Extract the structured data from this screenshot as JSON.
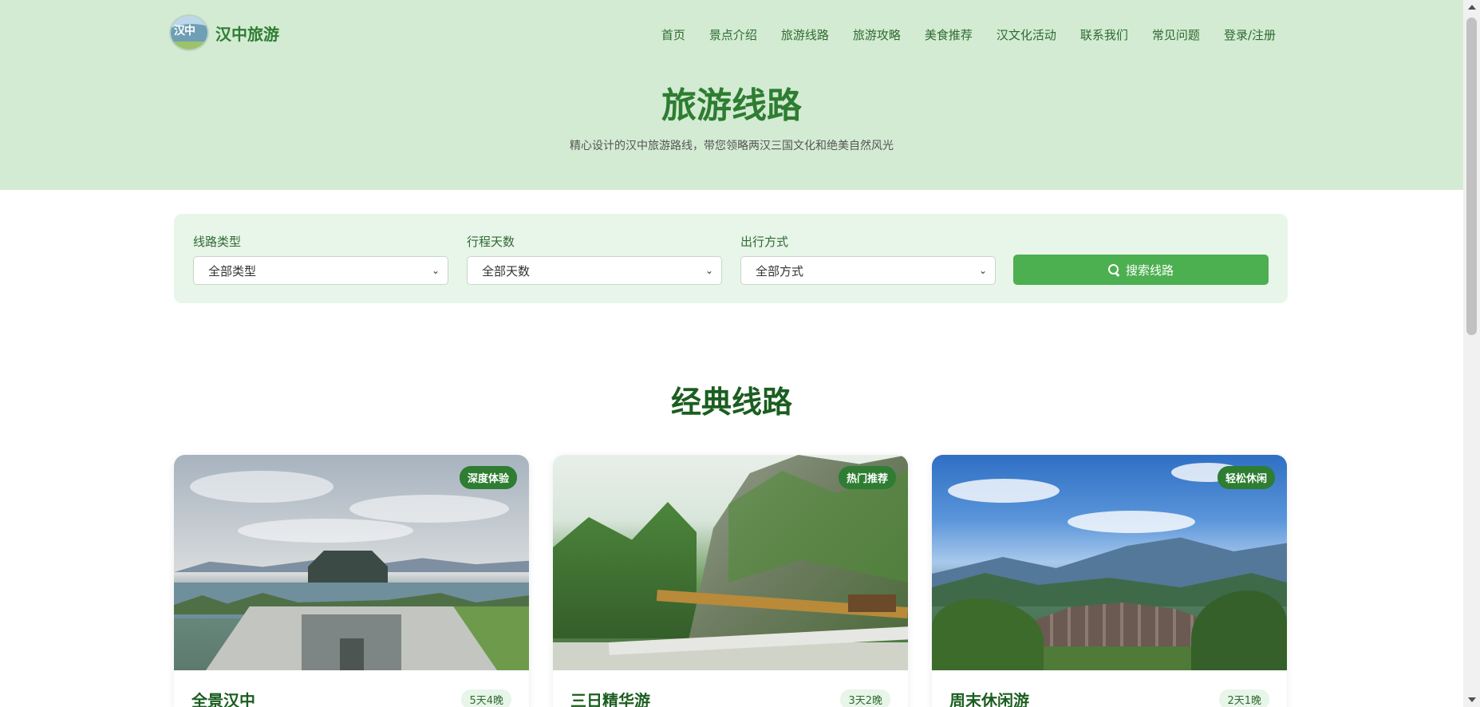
{
  "brand": {
    "name": "汉中旅游",
    "logo_glyph": "汉中"
  },
  "nav": {
    "items": [
      "首页",
      "景点介绍",
      "旅游线路",
      "旅游攻略",
      "美食推荐",
      "汉文化活动",
      "联系我们",
      "常见问题",
      "登录/注册"
    ]
  },
  "hero": {
    "title": "旅游线路",
    "subtitle": "精心设计的汉中旅游路线，带您领略两汉三国文化和绝美自然风光"
  },
  "filter": {
    "route_type": {
      "label": "线路类型",
      "value": "全部类型"
    },
    "days": {
      "label": "行程天数",
      "value": "全部天数"
    },
    "travel_mode": {
      "label": "出行方式",
      "value": "全部方式"
    },
    "search_label": "搜索线路"
  },
  "section": {
    "title": "经典线路"
  },
  "cards": [
    {
      "badge": "深度体验",
      "title": "全景汉中",
      "days": "5天4晚"
    },
    {
      "badge": "热门推荐",
      "title": "三日精华游",
      "days": "3天2晚"
    },
    {
      "badge": "轻松休闲",
      "title": "周末休闲游",
      "days": "2天1晚"
    }
  ],
  "colors": {
    "accent": "#4caf50",
    "brand": "#2e7d32",
    "hero_bg": "#d3ebd3",
    "panel_bg": "#e8f5e9"
  },
  "icons": {
    "search": "search-icon",
    "select_chevron": "chevron-down-icon"
  }
}
